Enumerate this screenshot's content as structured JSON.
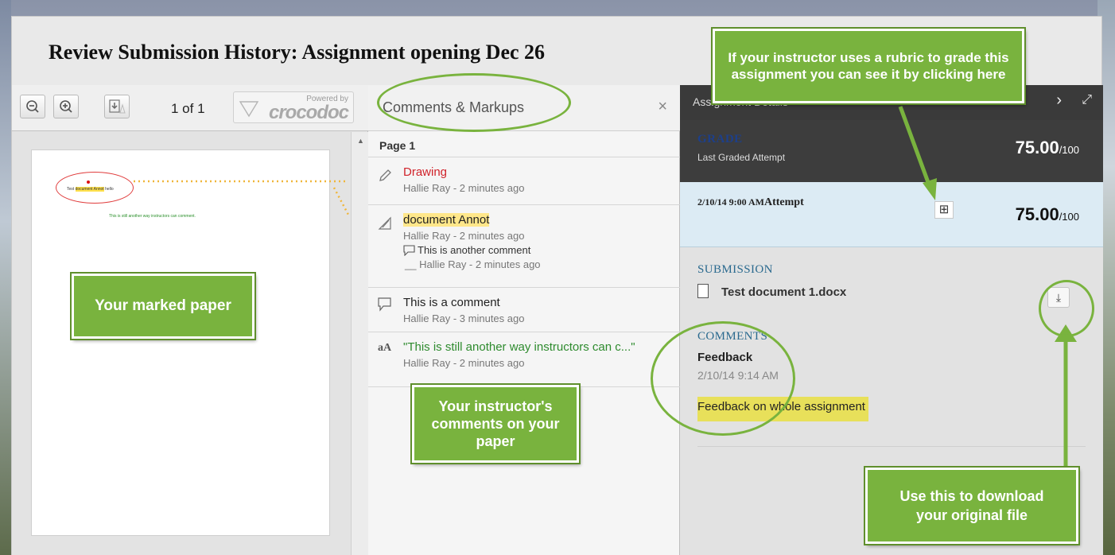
{
  "modal": {
    "title": "Review Submission History: Assignment opening Dec 26"
  },
  "viewer": {
    "zoom_out_icon": "zoom-out-icon",
    "zoom_in_icon": "zoom-in-icon",
    "download_icon": "download-icon",
    "page_counter": "1 of 1",
    "powered_by": "Powered by",
    "brand": "crocodoc",
    "doc_line1_a": "Test ",
    "doc_line1_hl": "document Annot",
    "doc_line1_b": " hello",
    "doc_line2": "This is still another way instructors can comment."
  },
  "comments": {
    "title": "Comments & Markups",
    "close": "×",
    "page_label": "Page 1",
    "items": [
      {
        "icon": "pencil-icon",
        "title": "Drawing",
        "meta": "Hallie Ray - 2 minutes ago"
      },
      {
        "icon": "highlighter-icon",
        "title": "document Annot",
        "meta": "Hallie Ray - 2 minutes ago",
        "reply_text": "This is another comment",
        "reply_meta": "__ Hallie Ray - 2 minutes ago"
      },
      {
        "icon": "speech-bubble-icon",
        "title": "This is a comment",
        "meta": "Hallie Ray - 3 minutes ago"
      },
      {
        "icon": "text-size-icon",
        "icon_text": "aA",
        "title": "\"This is still another way instructors can c...\"",
        "meta": "Hallie Ray - 2 minutes ago"
      }
    ]
  },
  "details": {
    "header_title": "Assignment Details",
    "grade_label": "GRADE",
    "grade_sub": "Last Graded Attempt",
    "grade_score": "75.00",
    "grade_max": "/100",
    "attempt_date": "2/10/14 9:00 AM",
    "attempt_word": "Attempt",
    "attempt_score": "75.00",
    "attempt_max": "/100",
    "submission_label": "SUBMISSION",
    "file_name": "Test document 1.docx",
    "comments_label": "COMMENTS",
    "feedback_title": "Feedback",
    "feedback_date": "2/10/14 9:14 AM",
    "feedback_text": "Feedback on whole assignment"
  },
  "callouts": {
    "rubric": "If your instructor uses a rubric to grade this assignment you can see it by clicking here",
    "marked_paper": "Your marked paper",
    "instructor_comments": "Your instructor's comments on your paper",
    "download": "Use this to download your original file"
  },
  "colors": {
    "callout_green": "#79b33e",
    "grade_label_blue": "#1d3f8a",
    "section_blue": "#2b6a8f",
    "feedback_highlight": "#e8e05a"
  }
}
